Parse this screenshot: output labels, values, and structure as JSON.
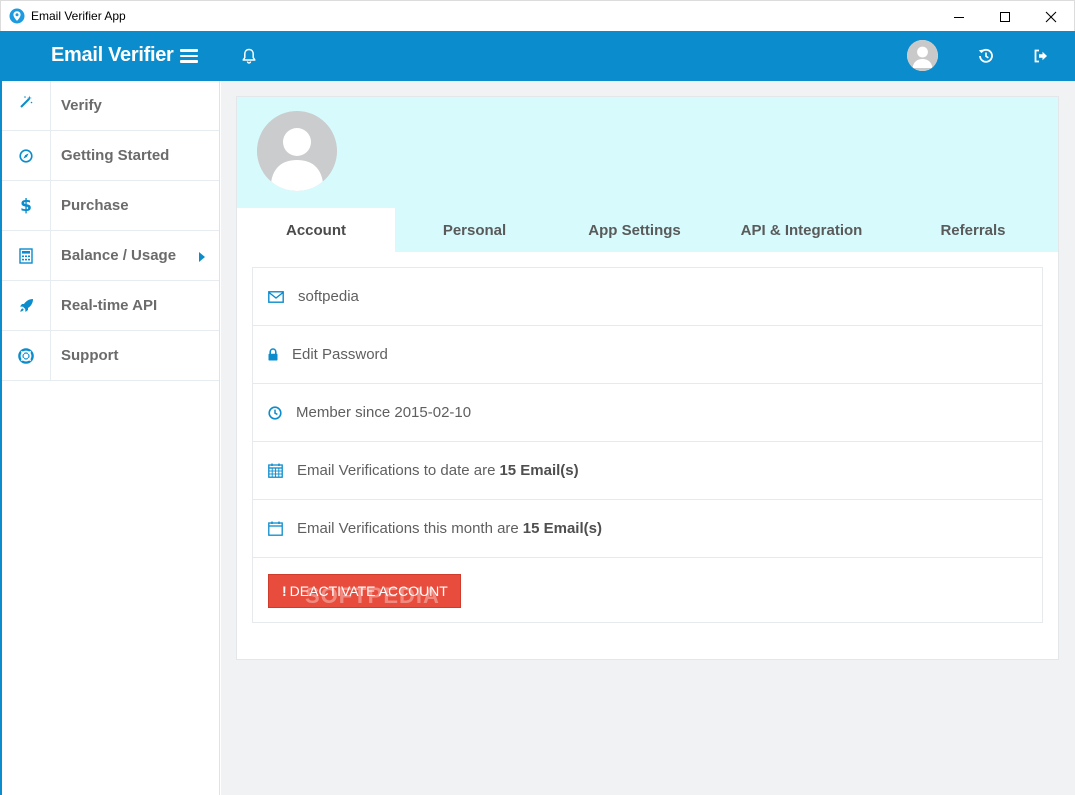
{
  "window": {
    "title": "Email Verifier App"
  },
  "header": {
    "brand": "Email Verifier"
  },
  "sidebar": {
    "items": [
      {
        "label": "Verify",
        "icon": "magic-wand-icon"
      },
      {
        "label": "Getting Started",
        "icon": "compass-icon"
      },
      {
        "label": "Purchase",
        "icon": "dollar-icon"
      },
      {
        "label": "Balance / Usage",
        "icon": "calculator-icon"
      },
      {
        "label": "Real-time API",
        "icon": "rocket-icon"
      },
      {
        "label": "Support",
        "icon": "lifebuoy-icon"
      }
    ]
  },
  "profile": {
    "tabs": [
      {
        "label": "Account"
      },
      {
        "label": "Personal"
      },
      {
        "label": "App Settings"
      },
      {
        "label": "API & Integration"
      },
      {
        "label": "Referrals"
      }
    ],
    "rows": {
      "username": "softpedia",
      "edit_password": "Edit Password",
      "member_since": "Member since 2015-02-10",
      "verifications_total_text": "Email Verifications to date are",
      "verifications_total_value": "15 Email(s)",
      "verifications_month_text": "Email Verifications this month are",
      "verifications_month_value": "15 Email(s)"
    },
    "deactivate_excl": "!",
    "deactivate_label": "DEACTIVATE ACCOUNT",
    "watermark": "SOFTPEDIA"
  },
  "colors": {
    "accent": "#0b8ccc",
    "header_bg": "#d7fbfd",
    "danger": "#e74c3c"
  }
}
